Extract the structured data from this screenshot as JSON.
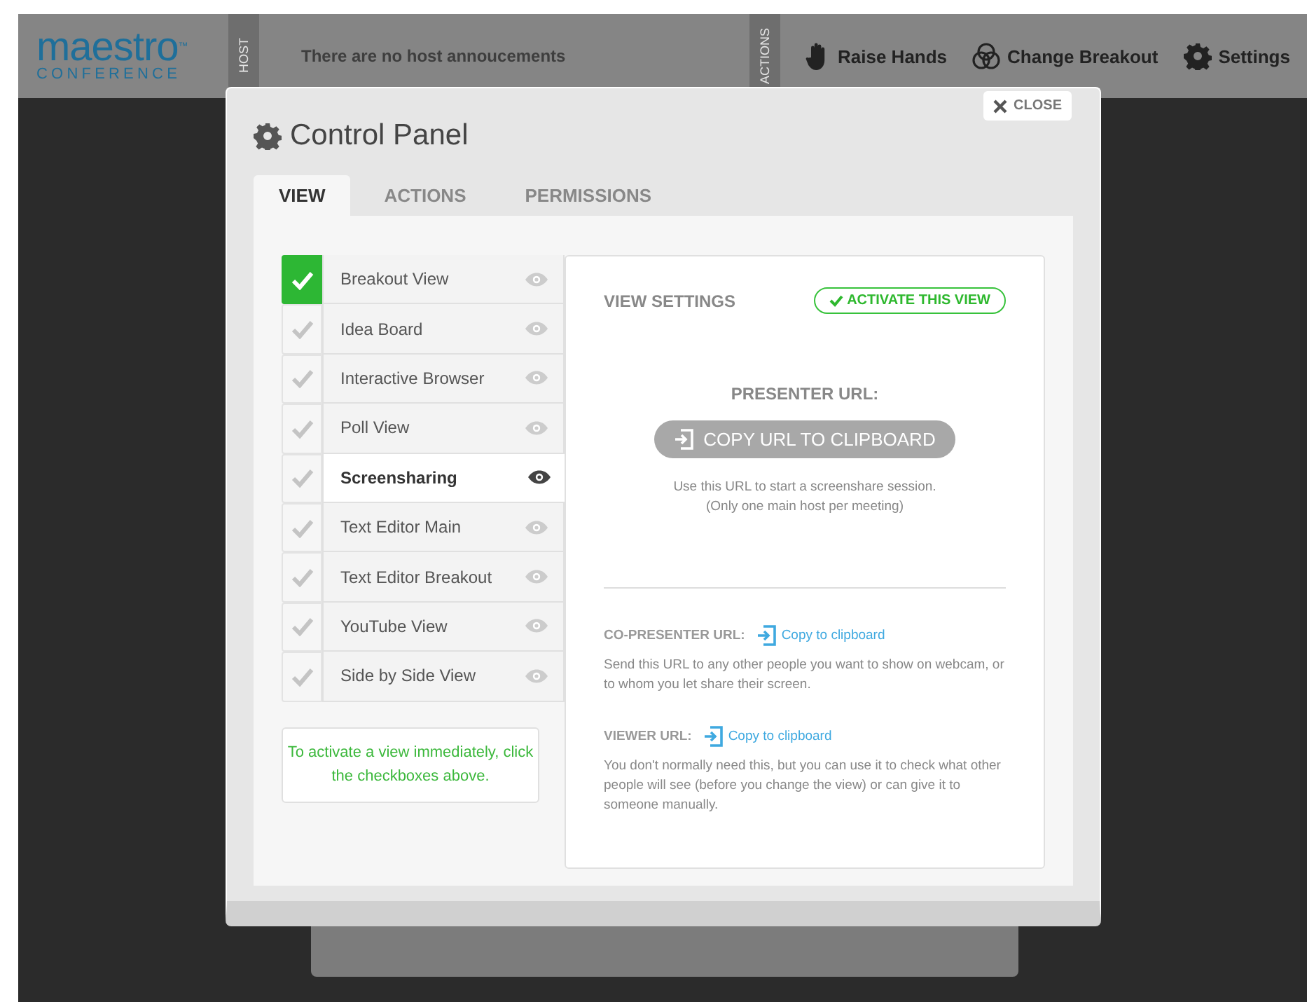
{
  "topbar": {
    "logo": "maestro",
    "logo_tm": "™",
    "logo_sub": "CONFERENCE",
    "host_label": "HOST",
    "announcement": "There are no host annoucements",
    "actions_label": "ACTIONS",
    "actions": [
      {
        "kind": "hand",
        "label": "Raise Hands"
      },
      {
        "kind": "circles",
        "label": "Change Breakout"
      },
      {
        "kind": "gear",
        "label": "Settings"
      }
    ]
  },
  "dialog": {
    "title": "Control Panel",
    "close": "CLOSE",
    "tabs": [
      {
        "label": "VIEW",
        "selected": true
      },
      {
        "label": "ACTIONS",
        "selected": false
      },
      {
        "label": "PERMISSIONS",
        "selected": false
      }
    ],
    "views": [
      {
        "label": "Breakout View",
        "checked": true,
        "selected": false
      },
      {
        "label": "Idea Board",
        "checked": false,
        "selected": false
      },
      {
        "label": "Interactive Browser",
        "checked": false,
        "selected": false
      },
      {
        "label": "Poll View",
        "checked": false,
        "selected": false
      },
      {
        "label": "Screensharing",
        "checked": false,
        "selected": true
      },
      {
        "label": "Text Editor Main",
        "checked": false,
        "selected": false
      },
      {
        "label": "Text Editor Breakout",
        "checked": false,
        "selected": false
      },
      {
        "label": "YouTube View",
        "checked": false,
        "selected": false
      },
      {
        "label": "Side by Side View",
        "checked": false,
        "selected": false
      }
    ],
    "hint": "To activate a view immediately, click the checkboxes above.",
    "settings": {
      "heading": "VIEW SETTINGS",
      "activate": "ACTIVATE THIS VIEW",
      "presenter_label": "PRESENTER URL:",
      "copy_button": "COPY URL TO CLIPBOARD",
      "presenter_note_1": "Use this URL to start a screenshare session.",
      "presenter_note_2": "(Only one main host per meeting)",
      "urls": [
        {
          "label": "CO-PRESENTER URL:",
          "link": "Copy to clipboard",
          "note": "Send this URL to any other people you want to show on webcam, or to whom you let share their screen."
        },
        {
          "label": "VIEWER URL:",
          "link": "Copy to clipboard",
          "note": "You don't normally need this, but you can use it to check what other people will see (before you change the view) or can give it to someone manually."
        }
      ]
    }
  }
}
